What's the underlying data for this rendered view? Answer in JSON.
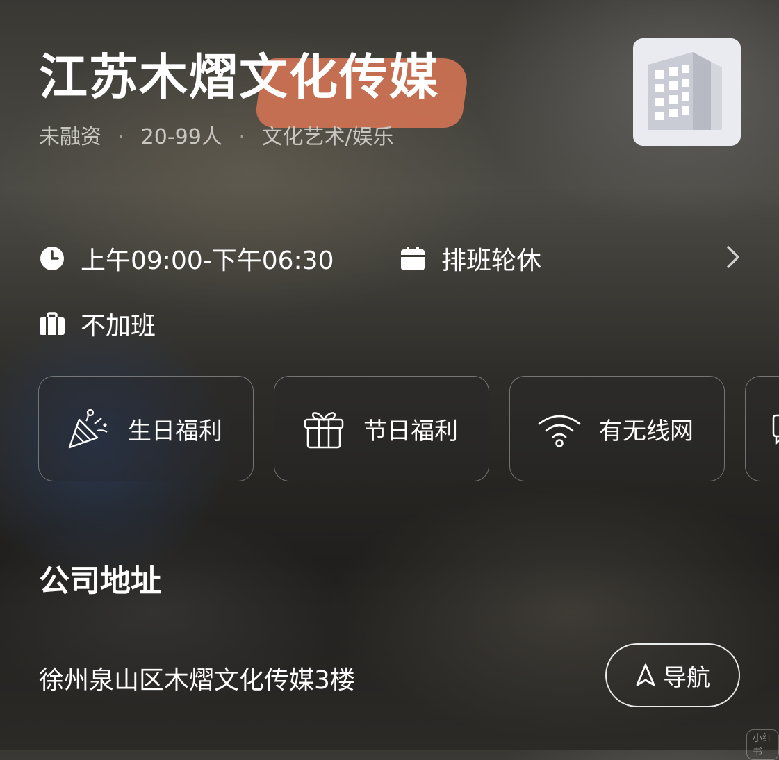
{
  "company": {
    "name_plain": "江苏木熠",
    "name_highlight": "文化传媒",
    "funding": "未融资",
    "size": "20-99人",
    "industry": "文化艺术/娱乐",
    "separator": "·",
    "logo_icon": "building-icon"
  },
  "schedule": {
    "hours": "上午09:00-下午06:30",
    "shift": "排班轮休",
    "overtime": "不加班"
  },
  "benefits": [
    {
      "label": "生日福利",
      "icon": "party-popper-icon"
    },
    {
      "label": "节日福利",
      "icon": "gift-icon"
    },
    {
      "label": "有无线网",
      "icon": "wifi-icon"
    }
  ],
  "address_section": {
    "title": "公司地址",
    "address": "徐州泉山区木熠文化传媒3楼",
    "nav_label": "导航"
  },
  "colors": {
    "highlight": "#cf7254"
  },
  "watermark": "小红书"
}
